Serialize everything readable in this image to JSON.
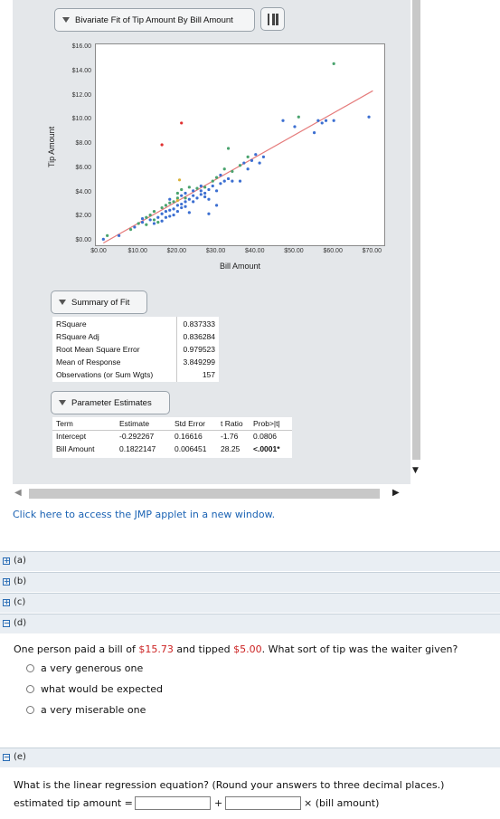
{
  "applet": {
    "title_button": "Bivariate Fit of Tip Amount By Bill Amount",
    "summary_button": "Summary of Fit",
    "params_button": "Parameter Estimates",
    "link_text": "Click here to access the JMP applet in a new window."
  },
  "chart_data": {
    "type": "scatter",
    "title": "Bivariate Fit of Tip Amount By Bill Amount",
    "xlabel": "Bill Amount",
    "ylabel": "Tip Amount",
    "x_ticks": [
      "$0.00",
      "$10.00",
      "$20.00",
      "$30.00",
      "$40.00",
      "$50.00",
      "$60.00",
      "$70.00"
    ],
    "y_ticks": [
      "$0.00",
      "$2.00",
      "$4.00",
      "$6.00",
      "$8.00",
      "$10.00",
      "$12.00",
      "$14.00",
      "$16.00"
    ],
    "xlim": [
      0,
      72
    ],
    "ylim": [
      0,
      16
    ],
    "fit_line": {
      "intercept": -0.292267,
      "slope": 0.1822147,
      "color": "#e57b7b"
    },
    "points": [
      {
        "x": 1,
        "y": 0.2,
        "c": "#3c6fd1"
      },
      {
        "x": 2,
        "y": 0.5,
        "c": "#4aa36e"
      },
      {
        "x": 5,
        "y": 0.5,
        "c": "#3c6fd1"
      },
      {
        "x": 8,
        "y": 1.0,
        "c": "#4aa36e"
      },
      {
        "x": 9,
        "y": 1.2,
        "c": "#3c6fd1"
      },
      {
        "x": 10,
        "y": 1.5,
        "c": "#4aa36e"
      },
      {
        "x": 11,
        "y": 1.6,
        "c": "#3c6fd1"
      },
      {
        "x": 12,
        "y": 1.4,
        "c": "#4aa36e"
      },
      {
        "x": 12,
        "y": 2.0,
        "c": "#4aa36e"
      },
      {
        "x": 13,
        "y": 1.8,
        "c": "#3c6fd1"
      },
      {
        "x": 13,
        "y": 2.2,
        "c": "#4aa36e"
      },
      {
        "x": 14,
        "y": 1.5,
        "c": "#3c6fd1"
      },
      {
        "x": 14,
        "y": 2.5,
        "c": "#4aa36e"
      },
      {
        "x": 15,
        "y": 2.0,
        "c": "#3c6fd1"
      },
      {
        "x": 15,
        "y": 1.6,
        "c": "#4aa36e"
      },
      {
        "x": 16,
        "y": 2.3,
        "c": "#3c6fd1"
      },
      {
        "x": 16,
        "y": 2.8,
        "c": "#4aa36e"
      },
      {
        "x": 17,
        "y": 2.0,
        "c": "#3c6fd1"
      },
      {
        "x": 17,
        "y": 3.0,
        "c": "#4aa36e"
      },
      {
        "x": 17,
        "y": 2.5,
        "c": "#3c6fd1"
      },
      {
        "x": 18,
        "y": 3.2,
        "c": "#4aa36e"
      },
      {
        "x": 18,
        "y": 2.6,
        "c": "#3c6fd1"
      },
      {
        "x": 18,
        "y": 3.5,
        "c": "#3c6fd1"
      },
      {
        "x": 19,
        "y": 2.7,
        "c": "#3c6fd1"
      },
      {
        "x": 19,
        "y": 3.3,
        "c": "#4aa36e"
      },
      {
        "x": 19,
        "y": 2.2,
        "c": "#3c6fd1"
      },
      {
        "x": 20,
        "y": 3.0,
        "c": "#3c6fd1"
      },
      {
        "x": 20,
        "y": 3.6,
        "c": "#4aa36e"
      },
      {
        "x": 20,
        "y": 2.5,
        "c": "#3c6fd1"
      },
      {
        "x": 20,
        "y": 4.0,
        "c": "#4aa36e"
      },
      {
        "x": 21,
        "y": 3.1,
        "c": "#3c6fd1"
      },
      {
        "x": 21,
        "y": 2.8,
        "c": "#3c6fd1"
      },
      {
        "x": 21,
        "y": 3.8,
        "c": "#3c6fd1"
      },
      {
        "x": 21,
        "y": 4.3,
        "c": "#4aa36e"
      },
      {
        "x": 22,
        "y": 3.3,
        "c": "#3c6fd1"
      },
      {
        "x": 22,
        "y": 2.9,
        "c": "#3c6fd1"
      },
      {
        "x": 22,
        "y": 4.0,
        "c": "#3c6fd1"
      },
      {
        "x": 23,
        "y": 3.5,
        "c": "#3c6fd1"
      },
      {
        "x": 23,
        "y": 2.4,
        "c": "#3c6fd1"
      },
      {
        "x": 23,
        "y": 4.5,
        "c": "#4aa36e"
      },
      {
        "x": 24,
        "y": 3.8,
        "c": "#3c6fd1"
      },
      {
        "x": 24,
        "y": 4.2,
        "c": "#3c6fd1"
      },
      {
        "x": 25,
        "y": 3.6,
        "c": "#3c6fd1"
      },
      {
        "x": 25,
        "y": 4.4,
        "c": "#4aa36e"
      },
      {
        "x": 26,
        "y": 3.9,
        "c": "#3c6fd1"
      },
      {
        "x": 26,
        "y": 4.6,
        "c": "#3c6fd1"
      },
      {
        "x": 27,
        "y": 4.0,
        "c": "#3c6fd1"
      },
      {
        "x": 27,
        "y": 4.5,
        "c": "#4aa36e"
      },
      {
        "x": 28,
        "y": 4.3,
        "c": "#3c6fd1"
      },
      {
        "x": 28,
        "y": 3.5,
        "c": "#3c6fd1"
      },
      {
        "x": 28,
        "y": 2.3,
        "c": "#3c6fd1"
      },
      {
        "x": 29,
        "y": 4.6,
        "c": "#3c6fd1"
      },
      {
        "x": 29,
        "y": 5.0,
        "c": "#4aa36e"
      },
      {
        "x": 30,
        "y": 4.2,
        "c": "#3c6fd1"
      },
      {
        "x": 30,
        "y": 5.3,
        "c": "#4aa36e"
      },
      {
        "x": 30,
        "y": 3.0,
        "c": "#3c6fd1"
      },
      {
        "x": 31,
        "y": 4.8,
        "c": "#3c6fd1"
      },
      {
        "x": 31,
        "y": 5.5,
        "c": "#3c6fd1"
      },
      {
        "x": 32,
        "y": 5.0,
        "c": "#3c6fd1"
      },
      {
        "x": 32,
        "y": 6.0,
        "c": "#4aa36e"
      },
      {
        "x": 33,
        "y": 5.2,
        "c": "#3c6fd1"
      },
      {
        "x": 34,
        "y": 5.0,
        "c": "#3c6fd1"
      },
      {
        "x": 34,
        "y": 5.8,
        "c": "#4aa36e"
      },
      {
        "x": 36,
        "y": 5.0,
        "c": "#3c6fd1"
      },
      {
        "x": 36,
        "y": 6.3,
        "c": "#4aa36e"
      },
      {
        "x": 37,
        "y": 6.5,
        "c": "#3c6fd1"
      },
      {
        "x": 38,
        "y": 6.0,
        "c": "#3c6fd1"
      },
      {
        "x": 38,
        "y": 7.0,
        "c": "#4aa36e"
      },
      {
        "x": 39,
        "y": 6.7,
        "c": "#3c6fd1"
      },
      {
        "x": 40,
        "y": 7.2,
        "c": "#3c6fd1"
      },
      {
        "x": 41,
        "y": 6.5,
        "c": "#3c6fd1"
      },
      {
        "x": 42,
        "y": 7.0,
        "c": "#3c6fd1"
      },
      {
        "x": 11,
        "y": 1.9,
        "c": "#3c6fd1"
      },
      {
        "x": 14,
        "y": 1.8,
        "c": "#4aa36e"
      },
      {
        "x": 16,
        "y": 1.7,
        "c": "#3c6fd1"
      },
      {
        "x": 18,
        "y": 2.1,
        "c": "#3c6fd1"
      },
      {
        "x": 22,
        "y": 3.6,
        "c": "#4aa36e"
      },
      {
        "x": 24,
        "y": 3.3,
        "c": "#3c6fd1"
      },
      {
        "x": 26,
        "y": 4.2,
        "c": "#3c6fd1"
      },
      {
        "x": 27,
        "y": 3.7,
        "c": "#3c6fd1"
      },
      {
        "x": 20.5,
        "y": 5.1,
        "c": "#d9b23a"
      },
      {
        "x": 20,
        "y": 3.4,
        "c": "#d9b23a"
      },
      {
        "x": 33,
        "y": 7.7,
        "c": "#4aa36e"
      },
      {
        "x": 16,
        "y": 8.0,
        "c": "#e03030"
      },
      {
        "x": 21,
        "y": 9.8,
        "c": "#e03030"
      },
      {
        "x": 55,
        "y": 9.0,
        "c": "#3c6fd1"
      },
      {
        "x": 50,
        "y": 9.5,
        "c": "#3c6fd1"
      },
      {
        "x": 51,
        "y": 10.3,
        "c": "#4aa36e"
      },
      {
        "x": 56,
        "y": 10.0,
        "c": "#3c6fd1"
      },
      {
        "x": 57,
        "y": 9.8,
        "c": "#3c6fd1"
      },
      {
        "x": 58,
        "y": 10.0,
        "c": "#3c6fd1"
      },
      {
        "x": 60,
        "y": 10.0,
        "c": "#3c6fd1"
      },
      {
        "x": 69,
        "y": 10.3,
        "c": "#3c6fd1"
      },
      {
        "x": 47,
        "y": 10.0,
        "c": "#3c6fd1"
      },
      {
        "x": 60,
        "y": 14.7,
        "c": "#4aa36e"
      }
    ]
  },
  "summary_of_fit": [
    {
      "label": "RSquare",
      "value": "0.837333"
    },
    {
      "label": "RSquare Adj",
      "value": "0.836284"
    },
    {
      "label": "Root Mean Square Error",
      "value": "0.979523"
    },
    {
      "label": "Mean of Response",
      "value": "3.849299"
    },
    {
      "label": "Observations (or Sum Wgts)",
      "value": "157"
    }
  ],
  "parameter_estimates": {
    "headers": [
      "Term",
      "Estimate",
      "Std Error",
      "t Ratio",
      "Prob>|t|"
    ],
    "rows": [
      [
        "Intercept",
        "-0.292267",
        "0.16616",
        "-1.76",
        "0.0806"
      ],
      [
        "Bill Amount",
        "0.1822147",
        "0.006451",
        "28.25",
        "<.0001*"
      ]
    ]
  },
  "parts": [
    {
      "label": "(a)",
      "state": "+"
    },
    {
      "label": "(b)",
      "state": "+"
    },
    {
      "label": "(c)",
      "state": "+"
    },
    {
      "label": "(d)",
      "state": "−"
    },
    {
      "label": "(e)",
      "state": "−"
    }
  ],
  "question_d": {
    "pre": "One person paid a bill of ",
    "bill": "$15.73",
    "mid": " and tipped ",
    "tip": "$5.00",
    "post": ". What sort of tip was the waiter given?",
    "options": [
      "a very generous one",
      "what would be expected",
      "a very miserable one"
    ]
  },
  "question_e": {
    "text": "What is the linear regression equation? (Round your answers to three decimal places.)",
    "lhs": "estimated tip amount =",
    "plus": "+",
    "times": "× (bill amount)"
  }
}
